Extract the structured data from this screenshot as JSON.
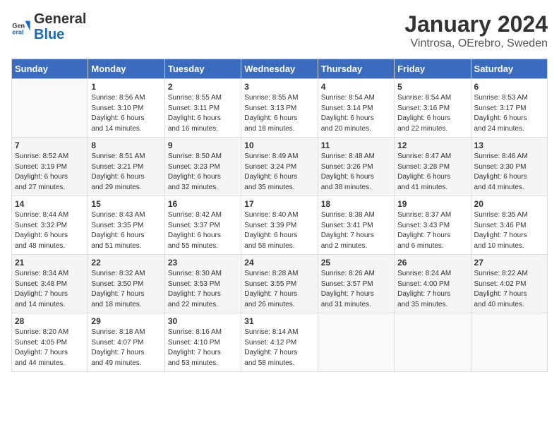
{
  "logo": {
    "general": "General",
    "blue": "Blue"
  },
  "title": "January 2024",
  "subtitle": "Vintrosa, OErebro, Sweden",
  "days_of_week": [
    "Sunday",
    "Monday",
    "Tuesday",
    "Wednesday",
    "Thursday",
    "Friday",
    "Saturday"
  ],
  "weeks": [
    [
      {
        "day": "",
        "info": ""
      },
      {
        "day": "1",
        "info": "Sunrise: 8:56 AM\nSunset: 3:10 PM\nDaylight: 6 hours\nand 14 minutes."
      },
      {
        "day": "2",
        "info": "Sunrise: 8:55 AM\nSunset: 3:11 PM\nDaylight: 6 hours\nand 16 minutes."
      },
      {
        "day": "3",
        "info": "Sunrise: 8:55 AM\nSunset: 3:13 PM\nDaylight: 6 hours\nand 18 minutes."
      },
      {
        "day": "4",
        "info": "Sunrise: 8:54 AM\nSunset: 3:14 PM\nDaylight: 6 hours\nand 20 minutes."
      },
      {
        "day": "5",
        "info": "Sunrise: 8:54 AM\nSunset: 3:16 PM\nDaylight: 6 hours\nand 22 minutes."
      },
      {
        "day": "6",
        "info": "Sunrise: 8:53 AM\nSunset: 3:17 PM\nDaylight: 6 hours\nand 24 minutes."
      }
    ],
    [
      {
        "day": "7",
        "info": "Sunrise: 8:52 AM\nSunset: 3:19 PM\nDaylight: 6 hours\nand 27 minutes."
      },
      {
        "day": "8",
        "info": "Sunrise: 8:51 AM\nSunset: 3:21 PM\nDaylight: 6 hours\nand 29 minutes."
      },
      {
        "day": "9",
        "info": "Sunrise: 8:50 AM\nSunset: 3:23 PM\nDaylight: 6 hours\nand 32 minutes."
      },
      {
        "day": "10",
        "info": "Sunrise: 8:49 AM\nSunset: 3:24 PM\nDaylight: 6 hours\nand 35 minutes."
      },
      {
        "day": "11",
        "info": "Sunrise: 8:48 AM\nSunset: 3:26 PM\nDaylight: 6 hours\nand 38 minutes."
      },
      {
        "day": "12",
        "info": "Sunrise: 8:47 AM\nSunset: 3:28 PM\nDaylight: 6 hours\nand 41 minutes."
      },
      {
        "day": "13",
        "info": "Sunrise: 8:46 AM\nSunset: 3:30 PM\nDaylight: 6 hours\nand 44 minutes."
      }
    ],
    [
      {
        "day": "14",
        "info": "Sunrise: 8:44 AM\nSunset: 3:32 PM\nDaylight: 6 hours\nand 48 minutes."
      },
      {
        "day": "15",
        "info": "Sunrise: 8:43 AM\nSunset: 3:35 PM\nDaylight: 6 hours\nand 51 minutes."
      },
      {
        "day": "16",
        "info": "Sunrise: 8:42 AM\nSunset: 3:37 PM\nDaylight: 6 hours\nand 55 minutes."
      },
      {
        "day": "17",
        "info": "Sunrise: 8:40 AM\nSunset: 3:39 PM\nDaylight: 6 hours\nand 58 minutes."
      },
      {
        "day": "18",
        "info": "Sunrise: 8:38 AM\nSunset: 3:41 PM\nDaylight: 7 hours\nand 2 minutes."
      },
      {
        "day": "19",
        "info": "Sunrise: 8:37 AM\nSunset: 3:43 PM\nDaylight: 7 hours\nand 6 minutes."
      },
      {
        "day": "20",
        "info": "Sunrise: 8:35 AM\nSunset: 3:46 PM\nDaylight: 7 hours\nand 10 minutes."
      }
    ],
    [
      {
        "day": "21",
        "info": "Sunrise: 8:34 AM\nSunset: 3:48 PM\nDaylight: 7 hours\nand 14 minutes."
      },
      {
        "day": "22",
        "info": "Sunrise: 8:32 AM\nSunset: 3:50 PM\nDaylight: 7 hours\nand 18 minutes."
      },
      {
        "day": "23",
        "info": "Sunrise: 8:30 AM\nSunset: 3:53 PM\nDaylight: 7 hours\nand 22 minutes."
      },
      {
        "day": "24",
        "info": "Sunrise: 8:28 AM\nSunset: 3:55 PM\nDaylight: 7 hours\nand 26 minutes."
      },
      {
        "day": "25",
        "info": "Sunrise: 8:26 AM\nSunset: 3:57 PM\nDaylight: 7 hours\nand 31 minutes."
      },
      {
        "day": "26",
        "info": "Sunrise: 8:24 AM\nSunset: 4:00 PM\nDaylight: 7 hours\nand 35 minutes."
      },
      {
        "day": "27",
        "info": "Sunrise: 8:22 AM\nSunset: 4:02 PM\nDaylight: 7 hours\nand 40 minutes."
      }
    ],
    [
      {
        "day": "28",
        "info": "Sunrise: 8:20 AM\nSunset: 4:05 PM\nDaylight: 7 hours\nand 44 minutes."
      },
      {
        "day": "29",
        "info": "Sunrise: 8:18 AM\nSunset: 4:07 PM\nDaylight: 7 hours\nand 49 minutes."
      },
      {
        "day": "30",
        "info": "Sunrise: 8:16 AM\nSunset: 4:10 PM\nDaylight: 7 hours\nand 53 minutes."
      },
      {
        "day": "31",
        "info": "Sunrise: 8:14 AM\nSunset: 4:12 PM\nDaylight: 7 hours\nand 58 minutes."
      },
      {
        "day": "",
        "info": ""
      },
      {
        "day": "",
        "info": ""
      },
      {
        "day": "",
        "info": ""
      }
    ]
  ]
}
